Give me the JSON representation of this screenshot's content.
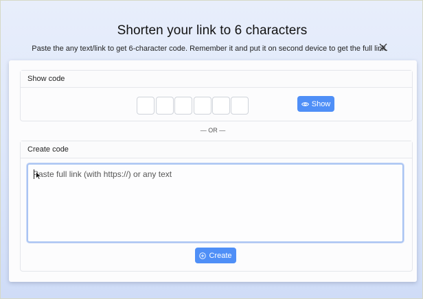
{
  "header": {
    "title": "Shorten your link to 6 characters",
    "subtitle": "Paste the any text/link to get 6-character code. Remember it and put it on second device to get the full link.",
    "close_icon": "close-icon"
  },
  "show_code": {
    "heading": "Show code",
    "code_boxes": [
      "",
      "",
      "",
      "",
      "",
      ""
    ],
    "button_label": "Show",
    "button_icon": "eye-icon"
  },
  "separator": "— OR —",
  "create_code": {
    "heading": "Create code",
    "textarea_placeholder": "Paste full link (with https://) or any text",
    "button_label": "Create",
    "button_icon": "plus-circle-icon"
  },
  "colors": {
    "accent": "#4f8ff7",
    "focus_border": "#a9c4f3"
  }
}
